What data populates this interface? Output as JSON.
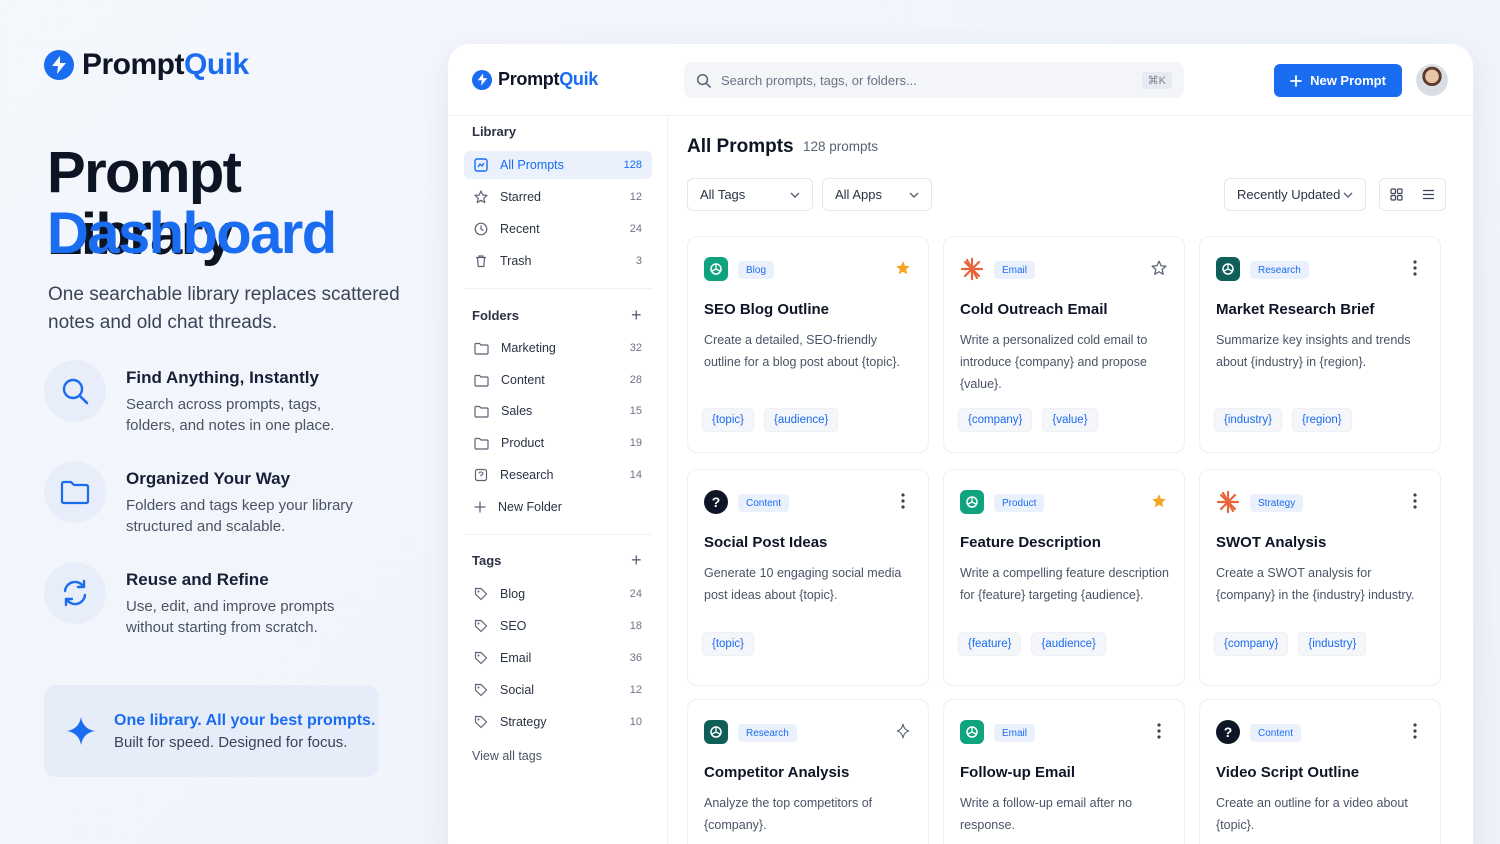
{
  "hero": {
    "brand_a": "Prompt",
    "brand_b": "Quik",
    "title_line1": "Prompt Library",
    "title_line2": "Dashboard",
    "subtitle": "One searchable library replaces scattered notes and old chat threads.",
    "features": [
      {
        "title": "Find Anything, Instantly",
        "desc": "Search across prompts, tags, folders, and notes in one place.",
        "icon": "search-icon"
      },
      {
        "title": "Organized Your Way",
        "desc": "Folders and tags keep your library structured and scalable.",
        "icon": "folder-icon"
      },
      {
        "title": "Reuse and Refine",
        "desc": "Use, edit, and improve prompts without starting from scratch.",
        "icon": "refresh-icon"
      }
    ],
    "promo_title": "One library. All your best prompts.",
    "promo_desc": "Built for speed. Designed for focus."
  },
  "topbar": {
    "brand_a": "Prompt",
    "brand_b": "Quik",
    "search_placeholder": "Search prompts, tags, or folders...",
    "shortcut": "⌘K",
    "new_prompt": "New Prompt"
  },
  "sidebar": {
    "library_heading": "Library",
    "library": [
      {
        "label": "All Prompts",
        "count": "128",
        "icon": "grid-icon",
        "active": true
      },
      {
        "label": "Starred",
        "count": "12",
        "icon": "star-icon"
      },
      {
        "label": "Recent",
        "count": "24",
        "icon": "clock-icon"
      },
      {
        "label": "Trash",
        "count": "3",
        "icon": "trash-icon"
      }
    ],
    "folders_heading": "Folders",
    "folders": [
      {
        "label": "Marketing",
        "count": "32"
      },
      {
        "label": "Content",
        "count": "28"
      },
      {
        "label": "Sales",
        "count": "15"
      },
      {
        "label": "Product",
        "count": "19"
      },
      {
        "label": "Research",
        "count": "14"
      }
    ],
    "new_folder": "New Folder",
    "tags_heading": "Tags",
    "tags": [
      {
        "label": "Blog",
        "count": "24"
      },
      {
        "label": "SEO",
        "count": "18"
      },
      {
        "label": "Email",
        "count": "36"
      },
      {
        "label": "Social",
        "count": "12"
      },
      {
        "label": "Strategy",
        "count": "10"
      }
    ],
    "view_all": "View all tags"
  },
  "main": {
    "title": "All Prompts",
    "count": "128 prompts",
    "filter_tags": "All Tags",
    "filter_apps": "All Apps",
    "sort": "Recently Updated"
  },
  "colors": {
    "accent": "#1a6cf0",
    "star": "#f5a524",
    "claude": "#e8643c",
    "gpt": "#10a37f"
  },
  "cards": [
    {
      "title": "SEO Blog Outline",
      "tag": "Blog",
      "desc": "Create a detailed, SEO-friendly outline for a blog post about {topic}.",
      "vars": [
        "{topic}",
        "{audience}"
      ],
      "app": "openai-icon",
      "action": "star-filled"
    },
    {
      "title": "Cold Outreach Email",
      "tag": "Email",
      "desc": "Write a personalized cold email to introduce {company} and propose {value}.",
      "vars": [
        "{company}",
        "{value}"
      ],
      "app": "claude-icon",
      "action": "star-outline"
    },
    {
      "title": "Market Research Brief",
      "tag": "Research",
      "desc": "Summarize key insights and trends about {industry} in {region}.",
      "vars": [
        "{industry}",
        "{region}"
      ],
      "app": "openai-dark-icon",
      "action": "more"
    },
    {
      "title": "Social Post Ideas",
      "tag": "Content",
      "desc": "Generate 10 engaging social media post ideas about {topic}.",
      "vars": [
        "{topic}"
      ],
      "app": "question-icon",
      "action": "more"
    },
    {
      "title": "Feature Description",
      "tag": "Product",
      "desc": "Write a compelling feature description for {feature} targeting {audience}.",
      "vars": [
        "{feature}",
        "{audience}"
      ],
      "app": "openai-icon",
      "action": "star-filled"
    },
    {
      "title": "SWOT Analysis",
      "tag": "Strategy",
      "desc": "Create a SWOT analysis for {company} in the {industry} industry.",
      "vars": [
        "{company}",
        "{industry}"
      ],
      "app": "claude-icon",
      "action": "more"
    },
    {
      "title": "Competitor Analysis",
      "tag": "Research",
      "desc": "Analyze the top competitors of {company}.",
      "vars": [],
      "app": "openai-dark-icon",
      "action": "sparkle"
    },
    {
      "title": "Follow-up Email",
      "tag": "Email",
      "desc": "Write a follow-up email after no response.",
      "vars": [],
      "app": "openai-icon",
      "action": "more"
    },
    {
      "title": "Video Script Outline",
      "tag": "Content",
      "desc": "Create an outline for a video about {topic}.",
      "vars": [],
      "app": "question-icon",
      "action": "more"
    }
  ]
}
